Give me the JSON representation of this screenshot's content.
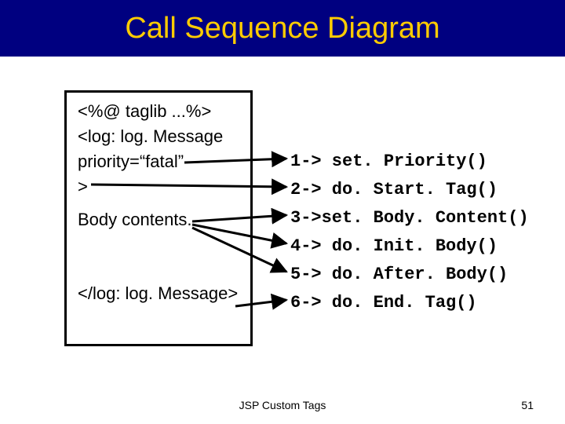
{
  "header": {
    "title": "Call Sequence Diagram"
  },
  "code": {
    "l1": "<%@ taglib ...%>",
    "l2": "<log: log. Message",
    "l3": "priority=“fatal”",
    "l4": ">",
    "l5": "Body contents.",
    "l6": "</log: log. Message>"
  },
  "steps": {
    "s1": "1-> set. Priority()",
    "s2": "2-> do. Start. Tag()",
    "s3": "3->set. Body. Content()",
    "s4": "4-> do. Init. Body()",
    "s5": "5-> do. After. Body()",
    "s6": "6-> do. End. Tag()"
  },
  "footer": {
    "label": "JSP Custom Tags",
    "page": "51"
  }
}
